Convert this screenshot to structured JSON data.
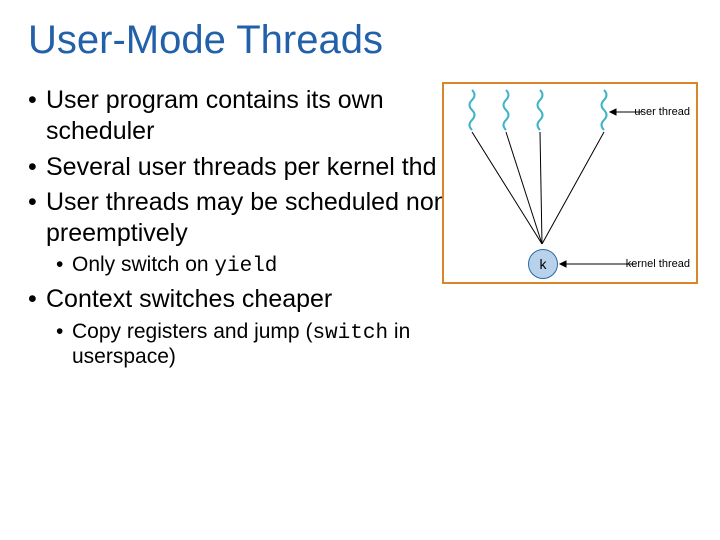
{
  "title": "User-Mode Threads",
  "bullets": {
    "b1": "User program contains its own scheduler",
    "b2": "Several user threads per kernel thd",
    "b3": "User threads may be scheduled non-preemptively",
    "b3s1_pre": "Only switch on ",
    "b3s1_code": "yield",
    "b4": "Context switches cheaper",
    "b4s1_pre": "Copy registers and jump (",
    "b4s1_code": "switch",
    "b4s1_post": " in userspace)"
  },
  "diagram": {
    "user_thread_label": "user thread",
    "kernel_thread_label": "kernel thread",
    "k": "k"
  }
}
